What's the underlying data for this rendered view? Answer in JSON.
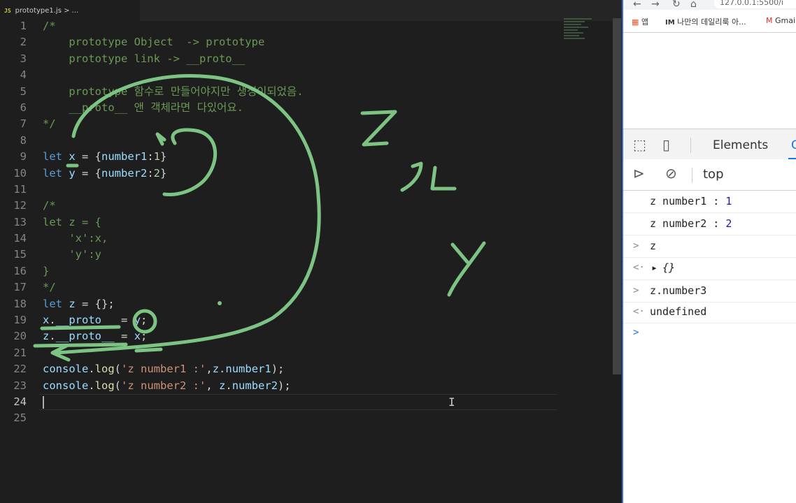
{
  "editor": {
    "tab": {
      "badge": "JS",
      "title": "prototype1.js > ..."
    },
    "current_line": "24",
    "lines": [
      {
        "n": "1",
        "t": [
          {
            "c": "cm",
            "s": "/*"
          }
        ]
      },
      {
        "n": "2",
        "t": [
          {
            "c": "cm",
            "s": "    prototype Object  -> prototype"
          }
        ]
      },
      {
        "n": "3",
        "t": [
          {
            "c": "cm",
            "s": "    prototype link -> __proto__"
          }
        ]
      },
      {
        "n": "4",
        "t": []
      },
      {
        "n": "5",
        "t": [
          {
            "c": "cm",
            "s": "    prototype 함수로 만들어야지만 생성이되었음."
          }
        ]
      },
      {
        "n": "6",
        "t": [
          {
            "c": "cm",
            "s": "    __proto__ 앤 객체라면 다있어요."
          }
        ]
      },
      {
        "n": "7",
        "t": [
          {
            "c": "cm",
            "s": "*/"
          }
        ]
      },
      {
        "n": "8",
        "t": []
      },
      {
        "n": "9",
        "t": [
          {
            "c": "kw",
            "s": "let "
          },
          {
            "c": "vr",
            "s": "x"
          },
          {
            "c": "pu",
            "s": " = {"
          },
          {
            "c": "vr",
            "s": "number1"
          },
          {
            "c": "pu",
            "s": ":"
          },
          {
            "c": "nm",
            "s": "1"
          },
          {
            "c": "pu",
            "s": "}"
          }
        ]
      },
      {
        "n": "10",
        "t": [
          {
            "c": "kw",
            "s": "let "
          },
          {
            "c": "vr",
            "s": "y"
          },
          {
            "c": "pu",
            "s": " = {"
          },
          {
            "c": "vr",
            "s": "number2"
          },
          {
            "c": "pu",
            "s": ":"
          },
          {
            "c": "nm",
            "s": "2"
          },
          {
            "c": "pu",
            "s": "}"
          }
        ]
      },
      {
        "n": "11",
        "t": []
      },
      {
        "n": "12",
        "t": [
          {
            "c": "cm",
            "s": "/*"
          }
        ]
      },
      {
        "n": "13",
        "t": [
          {
            "c": "cm",
            "s": "let z = {"
          }
        ]
      },
      {
        "n": "14",
        "t": [
          {
            "c": "cm",
            "s": "    'x':x,"
          }
        ]
      },
      {
        "n": "15",
        "t": [
          {
            "c": "cm",
            "s": "    'y':y"
          }
        ]
      },
      {
        "n": "16",
        "t": [
          {
            "c": "cm",
            "s": "}"
          }
        ]
      },
      {
        "n": "17",
        "t": [
          {
            "c": "cm",
            "s": "*/"
          }
        ]
      },
      {
        "n": "18",
        "t": [
          {
            "c": "kw",
            "s": "let "
          },
          {
            "c": "vr",
            "s": "z"
          },
          {
            "c": "pu",
            "s": " = {};"
          }
        ]
      },
      {
        "n": "19",
        "t": [
          {
            "c": "vr",
            "s": "x"
          },
          {
            "c": "pu",
            "s": "."
          },
          {
            "c": "vr",
            "s": "__proto__"
          },
          {
            "c": "pu",
            "s": " = "
          },
          {
            "c": "vr",
            "s": "y"
          },
          {
            "c": "pu",
            "s": ";"
          }
        ]
      },
      {
        "n": "20",
        "t": [
          {
            "c": "vr",
            "s": "z"
          },
          {
            "c": "pu",
            "s": "."
          },
          {
            "c": "vr",
            "s": "__proto__"
          },
          {
            "c": "pu",
            "s": " = "
          },
          {
            "c": "vr",
            "s": "x"
          },
          {
            "c": "pu",
            "s": ";"
          }
        ]
      },
      {
        "n": "21",
        "t": []
      },
      {
        "n": "22",
        "t": [
          {
            "c": "vr",
            "s": "console"
          },
          {
            "c": "pu",
            "s": "."
          },
          {
            "c": "fn",
            "s": "log"
          },
          {
            "c": "pu",
            "s": "("
          },
          {
            "c": "st",
            "s": "'z number1 :'"
          },
          {
            "c": "pu",
            "s": ","
          },
          {
            "c": "vr",
            "s": "z"
          },
          {
            "c": "pu",
            "s": "."
          },
          {
            "c": "vr",
            "s": "number1"
          },
          {
            "c": "pu",
            "s": ");"
          }
        ]
      },
      {
        "n": "23",
        "t": [
          {
            "c": "vr",
            "s": "console"
          },
          {
            "c": "pu",
            "s": "."
          },
          {
            "c": "fn",
            "s": "log"
          },
          {
            "c": "pu",
            "s": "("
          },
          {
            "c": "st",
            "s": "'z number2 :'"
          },
          {
            "c": "pu",
            "s": ", "
          },
          {
            "c": "vr",
            "s": "z"
          },
          {
            "c": "pu",
            "s": "."
          },
          {
            "c": "vr",
            "s": "number2"
          },
          {
            "c": "pu",
            "s": ");"
          }
        ]
      },
      {
        "n": "24",
        "t": []
      },
      {
        "n": "25",
        "t": []
      }
    ],
    "annotations": {
      "z": "Z",
      "arrow": "ㄱㄴ",
      "y": "Y"
    }
  },
  "browser": {
    "url": "127.0.0.1:5500/i",
    "bookmarks": {
      "apps": "앱",
      "im_badge": "IM",
      "blog": "나만의 데일리룩 아...",
      "gmail": "Gmail"
    },
    "devtools": {
      "tab_elements": "Elements",
      "tab_partial": "C",
      "context": "top"
    },
    "console": {
      "log1_label": "z number1 : ",
      "log1_value": "1",
      "log2_label": "z number2 : ",
      "log2_value": "2",
      "input1": "z",
      "output1": "{}",
      "input2": "z.number3",
      "output2": "undefined"
    }
  },
  "colors": {
    "ink": "#7dc383",
    "accent": "#3c6bd6"
  }
}
